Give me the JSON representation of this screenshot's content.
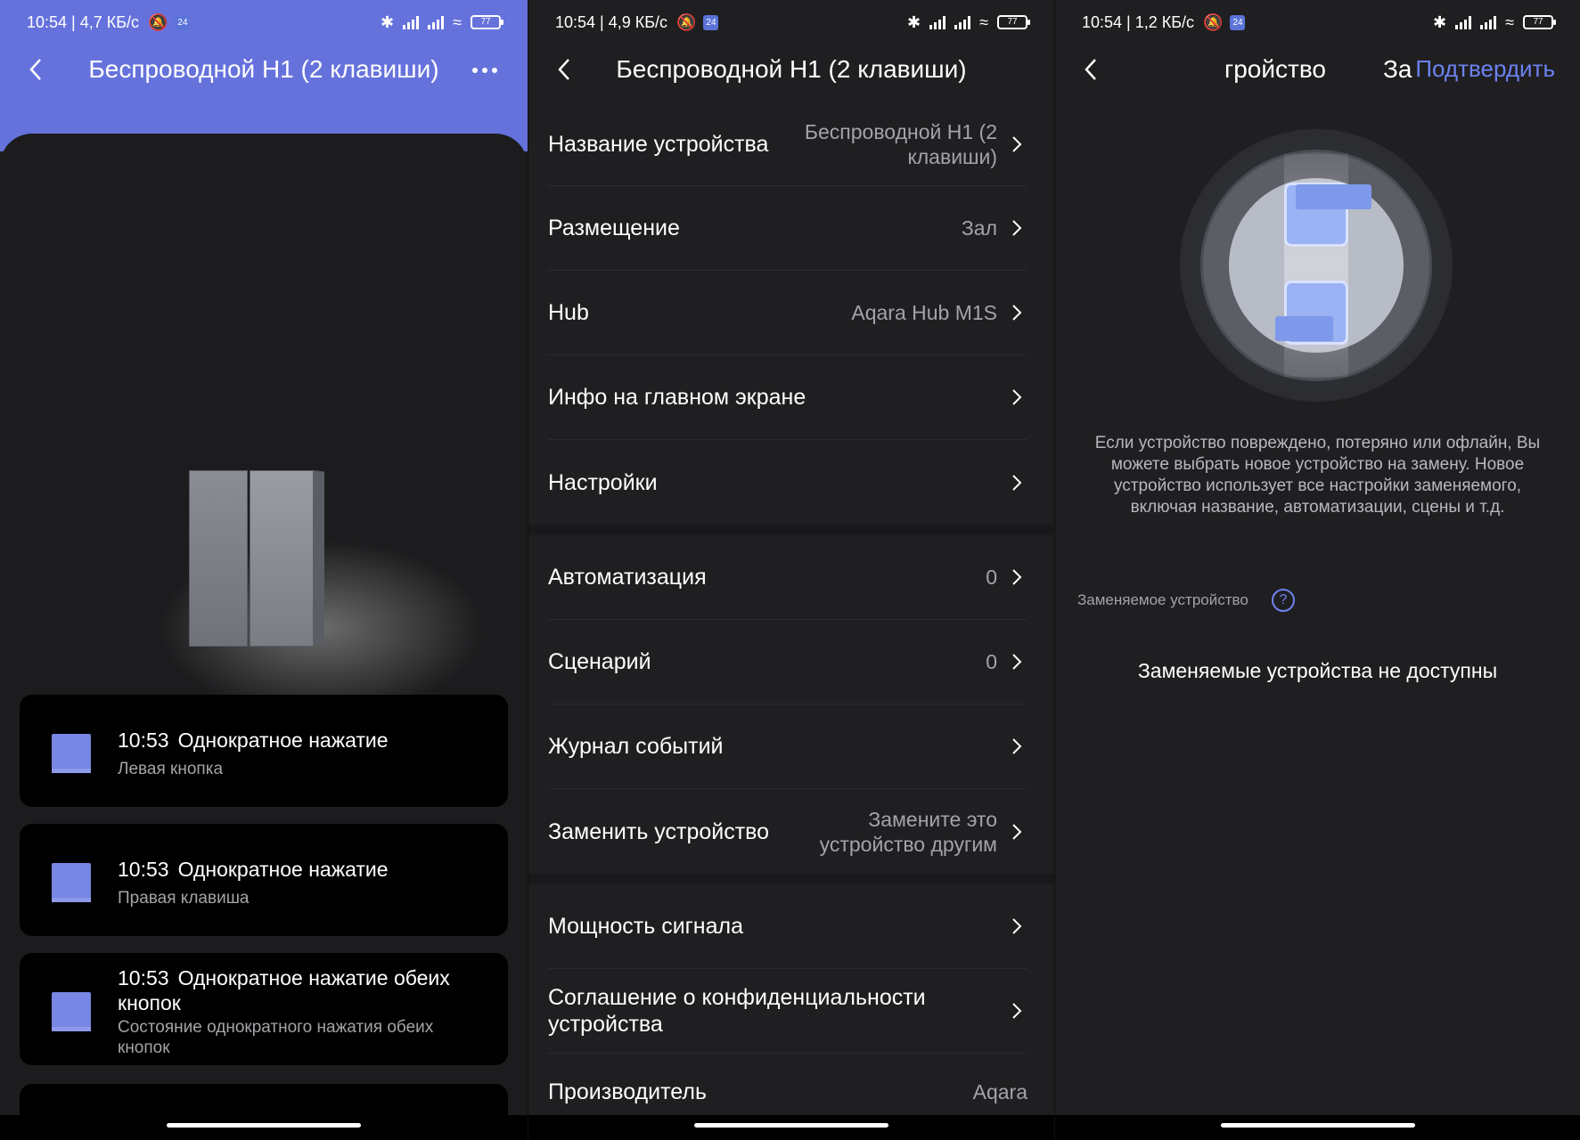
{
  "status_bars": [
    {
      "text": "10:54 | 4,7 КБ/с",
      "badge": "24",
      "battery": "77"
    },
    {
      "text": "10:54 | 4,9 КБ/с",
      "badge": "24",
      "battery": "77"
    },
    {
      "text": "10:54 | 1,2 КБ/с",
      "badge": "24",
      "battery": "77"
    }
  ],
  "panel1": {
    "title": "Беспроводной H1 (2 клавиши)",
    "accent": "#6672dc",
    "events": [
      {
        "time": "10:53",
        "action": "Однократное нажатие",
        "detail": "Левая кнопка"
      },
      {
        "time": "10:53",
        "action": "Однократное нажатие",
        "detail": "Правая клавиша"
      },
      {
        "time": "10:53",
        "action": "Однократное нажатие обеих кнопок",
        "detail": "Состояние однократного нажатия обеих кнопок"
      }
    ]
  },
  "panel2": {
    "title": "Беспроводной H1 (2 клавиши)",
    "rows": [
      {
        "label": "Название устройства",
        "value": "Беспроводной H1 (2 клавиши)"
      },
      {
        "label": "Размещение",
        "value": "Зал"
      },
      {
        "label": "Hub",
        "value": "Aqara Hub M1S"
      },
      {
        "label": "Инфо на главном экране",
        "value": ""
      },
      {
        "label": "Настройки",
        "value": ""
      },
      {
        "label": "Автоматизация",
        "value": "0"
      },
      {
        "label": "Сценарий",
        "value": "0"
      },
      {
        "label": "Журнал событий",
        "value": ""
      },
      {
        "label": "Заменить устройство",
        "value": "Замените это устройство другим"
      },
      {
        "label": "Мощность сигнала",
        "value": ""
      },
      {
        "label": "Соглашение о конфиденциальности устройства",
        "value": ""
      },
      {
        "label": "Производитель",
        "value": "Aqara"
      }
    ]
  },
  "panel3": {
    "title_fragment": "гройство",
    "title_fragment2": "За",
    "confirm": "Подтвердить",
    "explanation": "Если устройство повреждено, потеряно или офлайн, Вы можете выбрать новое устройство на замену. Новое устройство использует все настройки заменяемого, включая название, автоматизации, сцены и т.д.",
    "replaced_label": "Заменяемое устройство",
    "help": "?",
    "empty_message": "Заменяемые устройства не доступны",
    "link_color": "#6d82ef"
  }
}
